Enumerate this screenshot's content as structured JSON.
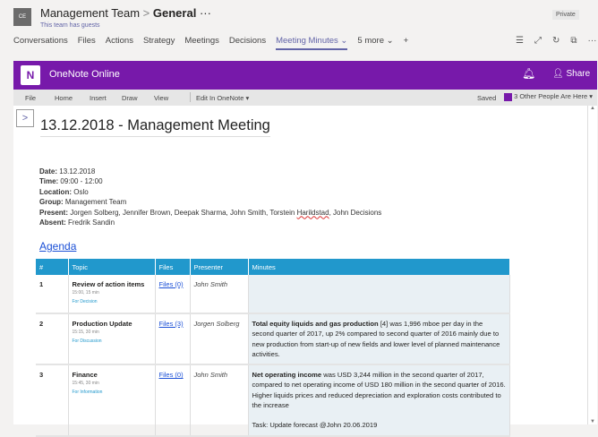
{
  "header": {
    "avatar": "CE",
    "team": "Management Team",
    "separator": ">",
    "channel": "General",
    "more": "···",
    "guests": "This team has guests",
    "private": "Private"
  },
  "tabs": [
    "Conversations",
    "Files",
    "Actions",
    "Strategy",
    "Meetings",
    "Decisions",
    "Meeting Minutes ⌄",
    "5 more ⌄",
    "+"
  ],
  "tab_icons": [
    "☰",
    "⤢",
    "↻",
    "⧉",
    "···"
  ],
  "onenote": {
    "logo": "N",
    "title": "OneNote Online",
    "share": "Share"
  },
  "menu": {
    "items": [
      "File",
      "Home",
      "Insert",
      "Draw",
      "View",
      "Edit In OneNote ▾"
    ],
    "saved": "Saved",
    "people": "3 Other People Are Here ▾"
  },
  "page": {
    "title": "13.12.2018 - Management Meeting",
    "meta": [
      {
        "k": "Date:",
        "v": " 13.12.2018"
      },
      {
        "k": "Time:",
        "v": " 09:00 - 12:00"
      },
      {
        "k": "Location:",
        "v": " Oslo"
      },
      {
        "k": "Group:",
        "v": " Management Team"
      },
      {
        "k": "Present:",
        "v": " Jorgen Solberg, Jennifer Brown, Deepak Sharma, John Smith, Torstein Harildstad, John Decisions"
      },
      {
        "k": "Absent:",
        "v": " Fredrik Sandin"
      }
    ],
    "agenda": "Agenda"
  },
  "table": {
    "headers": [
      "#",
      "Topic",
      "Files",
      "Presenter",
      "Minutes"
    ],
    "rows": [
      {
        "num": "1",
        "topic": "Review of action items",
        "time": "15:00, 15 min",
        "cat": "For Decision",
        "files": "Files (0)",
        "presenter": "John Smith",
        "min_bold": "",
        "min_text": "",
        "task": ""
      },
      {
        "num": "2",
        "topic": "Production Update",
        "time": "15:15, 30 min",
        "cat": "For Discussion",
        "files": "Files (3)",
        "presenter": "Jorgen Solberg",
        "min_bold": "Total equity liquids and gas production",
        "min_text": " [4] was 1,996 mboe per day in the second quarter of 2017, up 2% compared to second quarter of 2016 mainly due to new production from start-up of new fields and lower level of planned maintenance activities.",
        "task": ""
      },
      {
        "num": "3",
        "topic": "Finance",
        "time": "15:45, 30 min",
        "cat": "For Information",
        "files": "Files (0)",
        "presenter": "John Smith",
        "min_bold": "Net operating income",
        "min_text": " was USD 3,244 million in the second quarter of 2017, compared to net operating income of USD 180 million in the second quarter of 2016. Higher liquids prices and reduced depreciation and exploration costs contributed to the increase",
        "task": "Task: Update forecast @John 20.06.2019"
      }
    ]
  }
}
